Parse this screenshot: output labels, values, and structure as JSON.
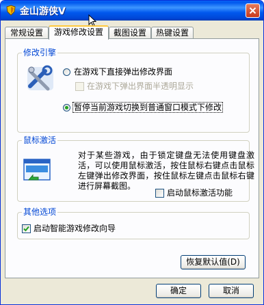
{
  "window": {
    "title": "金山游侠V"
  },
  "tabs": [
    {
      "label": "常规设置",
      "active": false
    },
    {
      "label": "游戏修改设置",
      "active": true
    },
    {
      "label": "截图设置",
      "active": false
    },
    {
      "label": "热键设置",
      "active": false
    }
  ],
  "modify_engine": {
    "legend": "修改引擎",
    "option_direct": "在游戏下直接弹出修改界面",
    "option_translucent": "在游戏下弹出界面半透明显示",
    "option_switch_window": "暂停当前游戏切换到普通窗口模式下修改",
    "selected": "option_switch_window"
  },
  "mouse_activation": {
    "legend": "鼠标激活",
    "description": "对于某些游戏，由于锁定键盘无法使用键盘激活，可以使用鼠标激活，按住鼠标右键点击鼠标左键弹出修改界面，按住鼠标左键点击鼠标右键进行屏幕截图。",
    "enable_label": "启动鼠标激活功能",
    "enabled": false
  },
  "other_options": {
    "legend": "其他选项",
    "wizard_label": "启动智能游戏修改向导",
    "wizard_enabled": true
  },
  "buttons": {
    "restore_defaults": "恢复默认值(D)",
    "ok": "确定",
    "cancel": "取消"
  }
}
